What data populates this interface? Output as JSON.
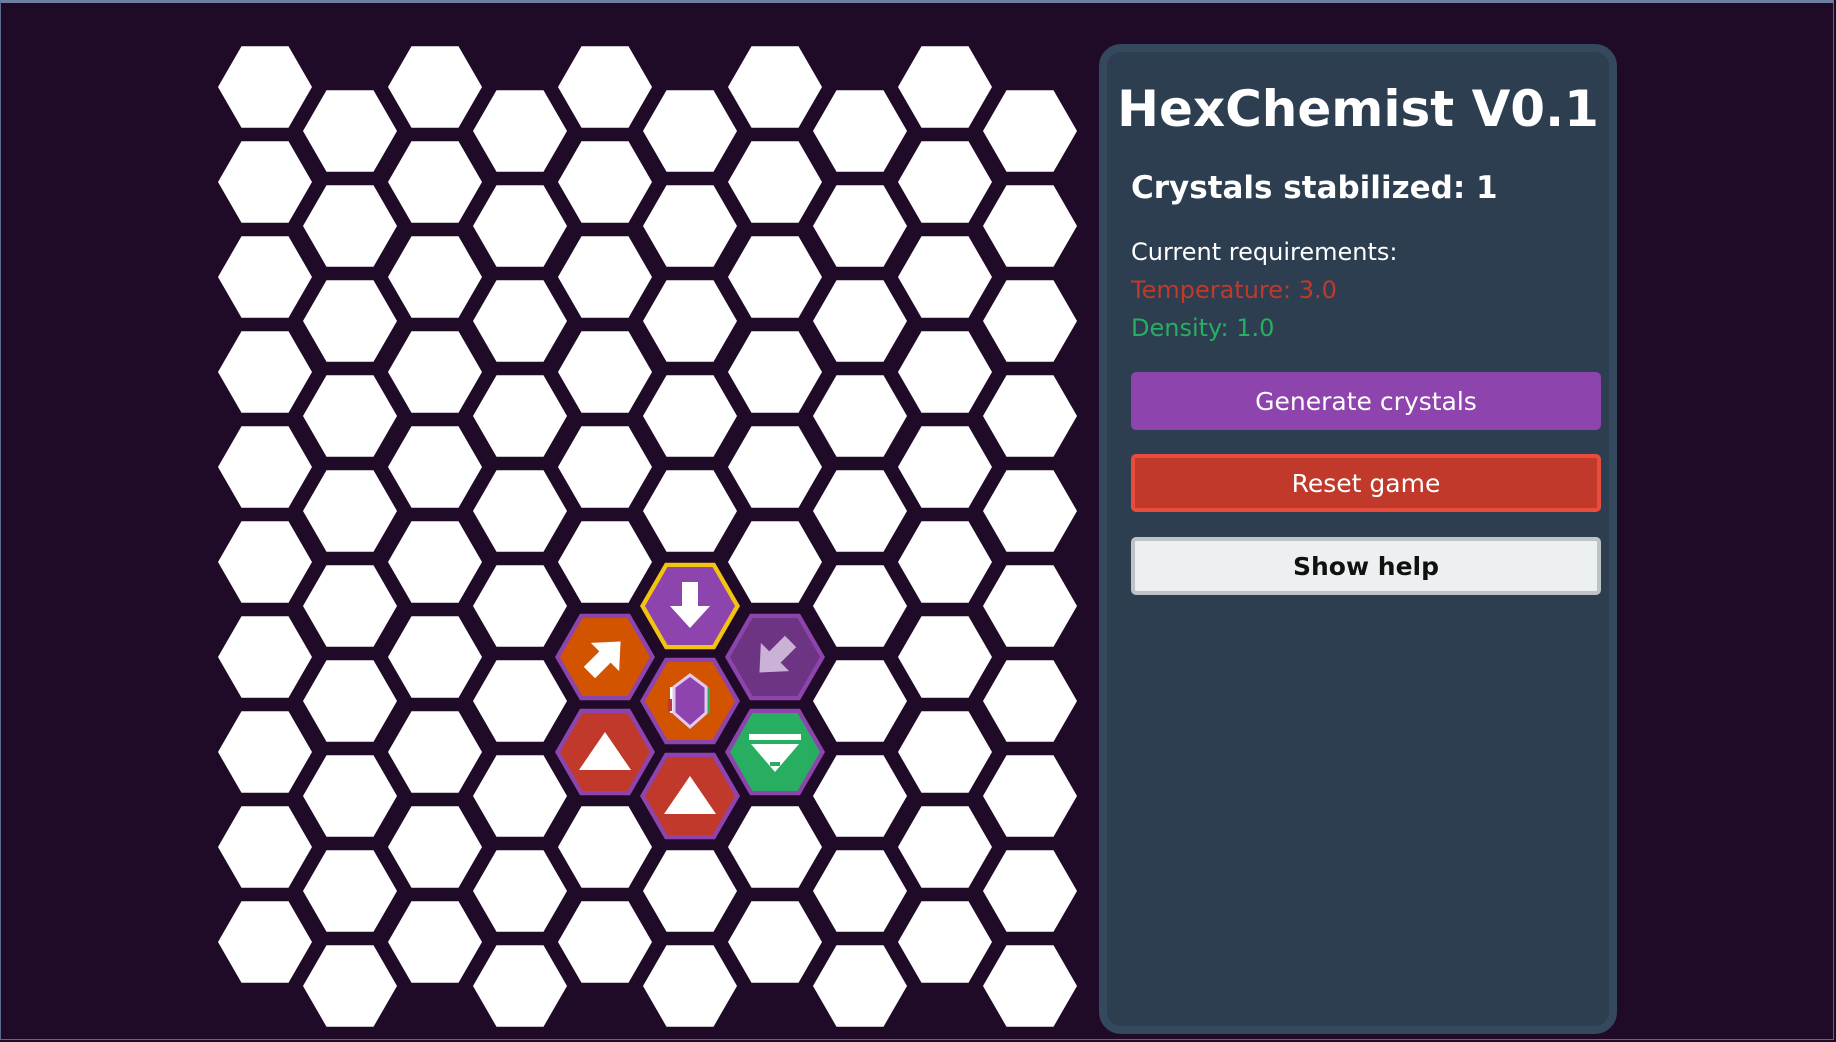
{
  "panel": {
    "title": "HexChemist V0.1",
    "crystals_stabilized": "Crystals stabilized: 1",
    "requirements_heading": "Current requirements:",
    "temperature": "Temperature: 3.0",
    "density": "Density: 1.0",
    "generate_label": "Generate crystals",
    "reset_label": "Reset game",
    "help_label": "Show help"
  },
  "colors": {
    "background": "#1f0b27",
    "empty_cell": "#ffffff",
    "purple": "#8e44ad",
    "dark_purple": "#6c3483",
    "orange": "#d35400",
    "red": "#c0392b",
    "green": "#27ae60",
    "gold_highlight": "#f1c40f"
  },
  "board": {
    "columns": 10,
    "rows": 10,
    "pieces": [
      {
        "col": 5,
        "row": 5,
        "kind": "arrow-down",
        "fill": "#8e44ad",
        "highlight": true
      },
      {
        "col": 4,
        "row": 6,
        "kind": "arrow-up-right",
        "fill": "#d35400"
      },
      {
        "col": 6,
        "row": 6,
        "kind": "arrow-down-left",
        "fill": "#6c3483",
        "faded": true
      },
      {
        "col": 5,
        "row": 6,
        "kind": "crystal",
        "fill": "#d35400"
      },
      {
        "col": 4,
        "row": 7,
        "kind": "triangle-up",
        "fill": "#c0392b"
      },
      {
        "col": 6,
        "row": 7,
        "kind": "triangle-down-bar",
        "fill": "#27ae60"
      },
      {
        "col": 5,
        "row": 7,
        "kind": "triangle-up",
        "fill": "#c0392b"
      }
    ]
  }
}
